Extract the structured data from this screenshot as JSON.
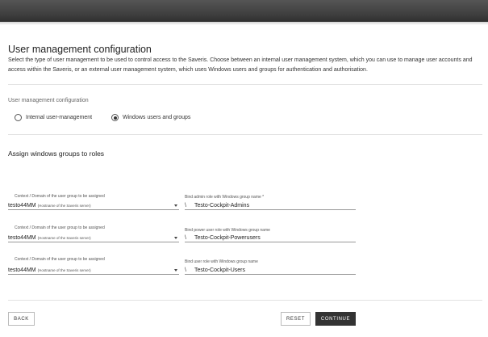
{
  "header": {
    "title": "User management configuration",
    "description": "Select the type of user management to be used to control access to the Saveris. Choose between an internal user management system, which you can use to manage user accounts and access within the Saveris, or an external user management system, which uses Windows users and groups for authentication and authorisation."
  },
  "user_management": {
    "section_label": "User management configuration",
    "options": [
      {
        "label": "Internal user-management",
        "selected": false
      },
      {
        "label": "Windows users and groups",
        "selected": true
      }
    ]
  },
  "roles": {
    "title": "Assign windows groups to roles",
    "rows": [
      {
        "domain_caption": "Context / Domain of the user group to be assigned",
        "domain_value": "testo44MM",
        "domain_hint": "(Hostname of the Saveris server)",
        "group_caption": "Bind admin role with Windows group name *",
        "group_prefix": "\\",
        "group_value": "Testo-Cockpit-Admins"
      },
      {
        "domain_caption": "Context / Domain of the user group to be assigned",
        "domain_value": "testo44MM",
        "domain_hint": "(Hostname of the Saveris server)",
        "group_caption": "Bind power user role with Windows group name",
        "group_prefix": "\\",
        "group_value": "Testo-Cockpit-Powerusers"
      },
      {
        "domain_caption": "Context / Domain of the user group to be assigned",
        "domain_value": "testo44MM",
        "domain_hint": "(Hostname of the Saveris server)",
        "group_caption": "Bind user role with Windows group name",
        "group_prefix": "\\",
        "group_value": "Testo-Cockpit-Users"
      }
    ]
  },
  "footer": {
    "back_label": "BACK",
    "reset_label": "RESET",
    "continue_label": "CONTINUE"
  },
  "colors": {
    "topbar": "#3d3d3d",
    "primary_button": "#333333",
    "divider": "#e2e2e2"
  },
  "icons": {
    "dropdown": "chevron-down-icon",
    "radio": "radio-icon"
  }
}
